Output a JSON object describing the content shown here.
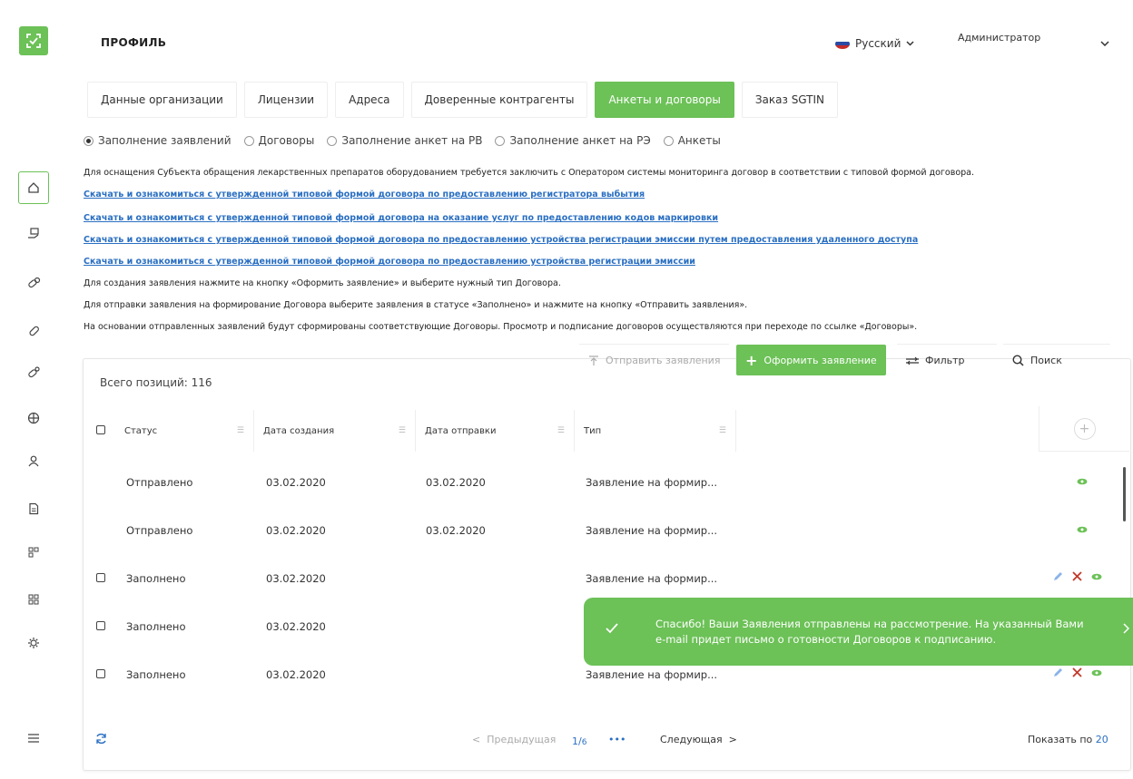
{
  "header": {
    "title": "ПРОФИЛЬ",
    "language": "Русский",
    "user": "Администратор"
  },
  "tabs": [
    {
      "label": "Данные организации",
      "active": false
    },
    {
      "label": "Лицензии",
      "active": false
    },
    {
      "label": "Адреса",
      "active": false
    },
    {
      "label": "Доверенные контрагенты",
      "active": false
    },
    {
      "label": "Анкеты и договоры",
      "active": true
    },
    {
      "label": "Заказ SGTIN",
      "active": false
    }
  ],
  "radios": [
    {
      "label": "Заполнение заявлений",
      "checked": true
    },
    {
      "label": "Договоры",
      "checked": false
    },
    {
      "label": "Заполнение анкет на РВ",
      "checked": false
    },
    {
      "label": "Заполнение анкет на РЭ",
      "checked": false
    },
    {
      "label": "Анкеты",
      "checked": false
    }
  ],
  "info": {
    "intro": "Для оснащения Субъекта обращения лекарственных препаратов оборудованием требуется заключить с Оператором системы мониторинга договор в соответствии с типовой формой договора.",
    "links": [
      "Скачать и ознакомиться с утвержденной типовой формой договора по предоставлению регистратора выбытия",
      "Скачать и ознакомиться с утвержденной типовой формой договора на оказание услуг по предоставлению кодов маркировки",
      "Скачать и ознакомиться с утвержденной типовой формой договора по предоставлению устройства регистрации эмиссии путем предоставления удаленного доступа",
      "Скачать и ознакомиться с утвержденной типовой формой договора по предоставлению устройства регистрации эмиссии"
    ],
    "notes": [
      "Для создания заявления нажмите на кнопку «Оформить заявление» и выберите нужный тип Договора.",
      "Для отправки заявления на формирование Договора выберите заявления в статусе «Заполнено» и нажмите на кнопку «Отправить заявления».",
      "На основании отправленных заявлений будут сформированы соответствующие Договоры. Просмотр и подписание договоров осуществляются при переходе по ссылке «Договоры»."
    ]
  },
  "toolbar": {
    "send_label": "Отправить заявления",
    "create_label": "Оформить заявление",
    "filter_label": "Фильтр",
    "search_label": "Поиск"
  },
  "table": {
    "total": "Всего позиций: 116",
    "columns": [
      "Статус",
      "Дата создания",
      "Дата отправки",
      "Тип"
    ],
    "rows": [
      {
        "status": "Отправлено",
        "created": "03.02.2020",
        "sent": "03.02.2020",
        "type": "Заявление на формир...",
        "checkbox": false,
        "editable": false
      },
      {
        "status": "Отправлено",
        "created": "03.02.2020",
        "sent": "03.02.2020",
        "type": "Заявление на формир...",
        "checkbox": false,
        "editable": false
      },
      {
        "status": "Заполнено",
        "created": "03.02.2020",
        "sent": "",
        "type": "Заявление на формир...",
        "checkbox": true,
        "editable": true
      },
      {
        "status": "Заполнено",
        "created": "03.02.2020",
        "sent": "",
        "type": "",
        "checkbox": true,
        "editable": true
      },
      {
        "status": "Заполнено",
        "created": "03.02.2020",
        "sent": "",
        "type": "Заявление на формир...",
        "checkbox": true,
        "editable": true
      }
    ]
  },
  "pagination": {
    "prev_label": "Предыдущая",
    "current": "1",
    "total": "6",
    "ellipsis": "•••",
    "next_label": "Следующая",
    "per_page_label": "Показать по",
    "per_page_value": "20"
  },
  "toast": {
    "message": "Спасибо! Ваши Заявления отправлены на рассмотрение. На указанный Вами e-mail придет письмо о готовности Договоров к подписанию."
  },
  "colors": {
    "accent": "#6cc157",
    "link": "#2a6fc2",
    "danger": "#c0392b"
  }
}
